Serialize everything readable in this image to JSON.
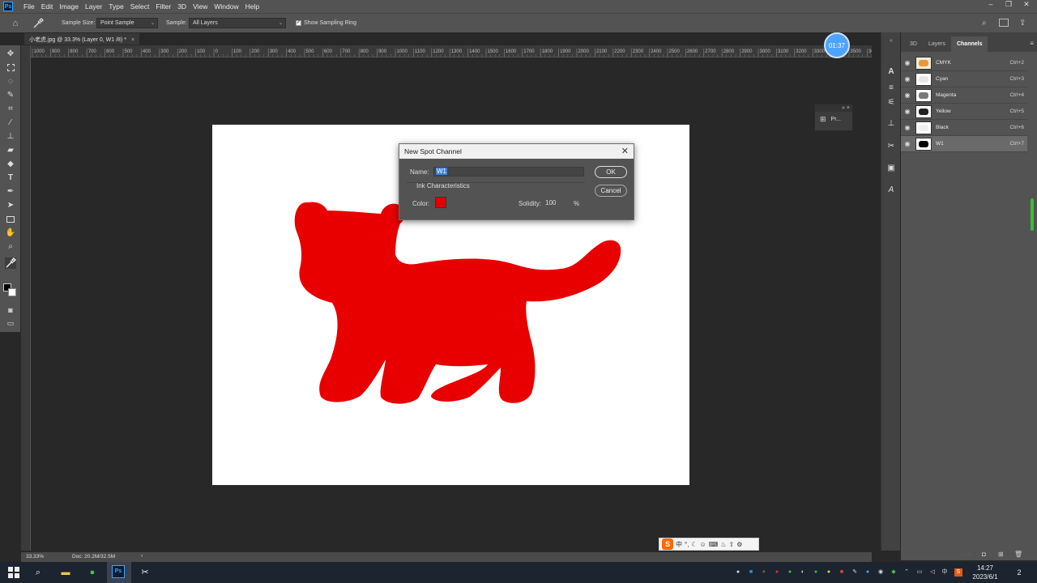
{
  "app": {
    "logo_text": "Ps",
    "menu": [
      "File",
      "Edit",
      "Image",
      "Layer",
      "Type",
      "Select",
      "Filter",
      "3D",
      "View",
      "Window",
      "Help"
    ],
    "window_controls": [
      "–",
      "❐",
      "✕"
    ]
  },
  "options_bar": {
    "sample_size_label": "Sample Size:",
    "sample_size_value": "Point Sample",
    "sample_label": "Sample:",
    "sample_value": "All Layers",
    "show_ring_label": "Show Sampling Ring",
    "show_ring_checked": true
  },
  "document": {
    "tab_title": "小老虎.jpg @ 33.3% (Layer 0, W1 /8) *",
    "close_glyph": "×",
    "ruler_ticks": [
      "1000",
      "900",
      "800",
      "700",
      "600",
      "500",
      "400",
      "300",
      "200",
      "100",
      "0",
      "100",
      "200",
      "300",
      "400",
      "500",
      "600",
      "700",
      "800",
      "900",
      "1000",
      "1100",
      "1200",
      "1300",
      "1400",
      "1500",
      "1600",
      "1700",
      "1800",
      "1900",
      "2000",
      "2100",
      "2200",
      "2300",
      "2400",
      "2500",
      "2600",
      "2700",
      "2800",
      "2900",
      "3000",
      "3100",
      "3200",
      "3300",
      "3400",
      "3500",
      "360"
    ],
    "fill_color": "#e80000"
  },
  "timer": {
    "text": "01:37"
  },
  "properties_mini": {
    "label": "Pr..."
  },
  "panel": {
    "tabs": [
      "3D",
      "Layers",
      "Channels"
    ],
    "active_tab": "Channels",
    "channels": [
      {
        "name": "CMYK",
        "shortcut": "Ctrl+2"
      },
      {
        "name": "Cyan",
        "shortcut": "Ctrl+3"
      },
      {
        "name": "Magenta",
        "shortcut": "Ctrl+4"
      },
      {
        "name": "Yellow",
        "shortcut": "Ctrl+5"
      },
      {
        "name": "Black",
        "shortcut": "Ctrl+6"
      },
      {
        "name": "W1",
        "shortcut": "Ctrl+7"
      }
    ]
  },
  "dialog": {
    "title": "New Spot Channel",
    "close_glyph": "✕",
    "name_label": "Name:",
    "name_value": "W1",
    "ok_label": "OK",
    "cancel_label": "Cancel",
    "ink_label": "Ink Characteristics",
    "color_label": "Color:",
    "color_value": "#e00000",
    "solidity_label": "Solidity:",
    "solidity_value": "100",
    "solidity_unit": "%"
  },
  "status": {
    "zoom": "33.33%",
    "doc": "Doc: 20.2M/32.5M",
    "arrow": "›"
  },
  "ime": {
    "logo": "S",
    "mode": "中"
  },
  "taskbar": {
    "time": "14:27",
    "date": "2023/6/1",
    "ime_indicator": "中",
    "notification_count": "2"
  }
}
